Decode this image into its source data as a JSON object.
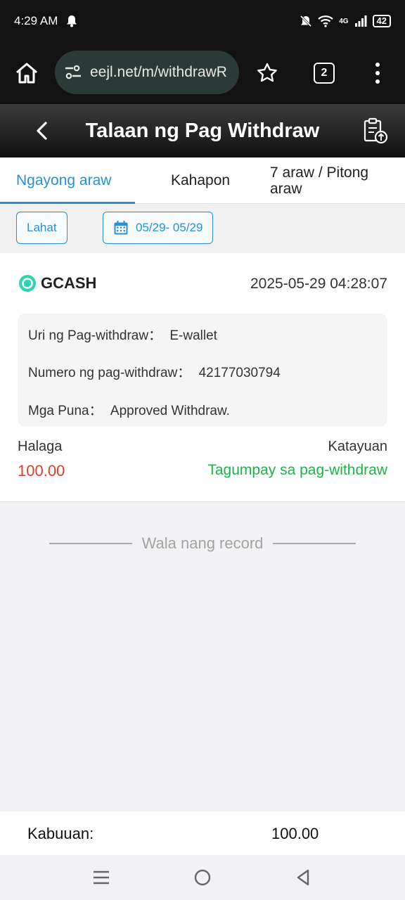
{
  "status_bar": {
    "time": "4:29 AM",
    "network": "4G",
    "battery": "42"
  },
  "browser": {
    "url": "eejl.net/m/withdrawR",
    "tab_count": "2"
  },
  "header": {
    "title": "Talaan ng Pag Withdraw"
  },
  "tabs": [
    {
      "label": "Ngayong araw",
      "active": true
    },
    {
      "label": "Kahapon",
      "active": false
    },
    {
      "label": "7 araw / Pitong araw",
      "active": false
    }
  ],
  "filters": {
    "all_label": "Lahat",
    "date_range": "05/29- 05/29"
  },
  "record": {
    "brand": "GCASH",
    "datetime": "2025-05-29 04:28:07",
    "type_label": "Uri ng Pag-withdraw：",
    "type_value": "E-wallet",
    "number_label": "Numero ng pag-withdraw：",
    "number_value": "42177030794",
    "remarks_label": "Mga Puna：",
    "remarks_value": "Approved Withdraw.",
    "amount_label": "Halaga",
    "status_label": "Katayuan",
    "amount": "100.00",
    "status": "Tagumpay sa pag-withdraw"
  },
  "no_more_text": "Wala nang record",
  "total": {
    "label": "Kabuuan:",
    "value": "100.00"
  },
  "colors": {
    "accent": "#2a8fd6",
    "amount": "#e53b2f",
    "success": "#1fb24a"
  }
}
